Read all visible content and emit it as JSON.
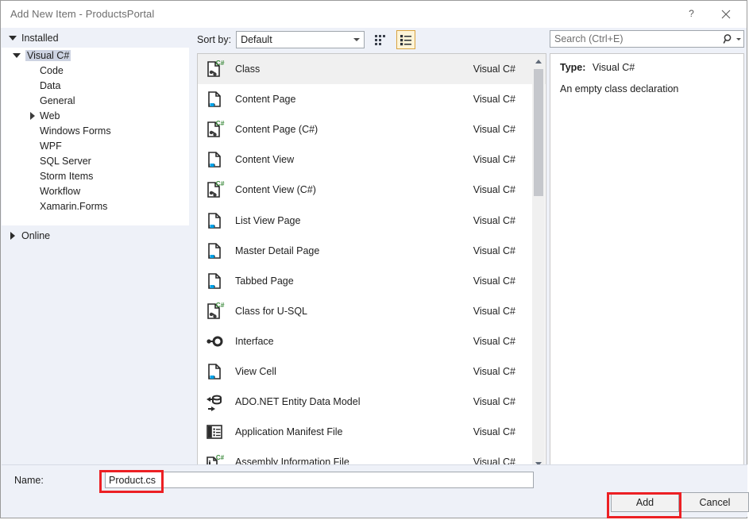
{
  "window": {
    "title": "Add New Item - ProductsPortal",
    "help_icon": "question-mark-icon",
    "close_icon": "close-icon"
  },
  "tree": {
    "installed": {
      "label": "Installed",
      "expanded_icon": "triangle-down-icon"
    },
    "online": {
      "label": "Online",
      "collapsed_icon": "triangle-right-icon"
    },
    "root": {
      "label": "Visual C#",
      "selected": true,
      "expanded_icon": "triangle-down-icon"
    },
    "children": [
      {
        "label": "Code",
        "expandable": false
      },
      {
        "label": "Data",
        "expandable": false
      },
      {
        "label": "General",
        "expandable": false
      },
      {
        "label": "Web",
        "expandable": true
      },
      {
        "label": "Windows Forms",
        "expandable": false
      },
      {
        "label": "WPF",
        "expandable": false
      },
      {
        "label": "SQL Server",
        "expandable": false
      },
      {
        "label": "Storm Items",
        "expandable": false
      },
      {
        "label": "Workflow",
        "expandable": false
      },
      {
        "label": "Xamarin.Forms",
        "expandable": false
      }
    ]
  },
  "toolbar": {
    "sort_by_label": "Sort by:",
    "sort_by_value": "Default",
    "sort_by_options": [
      "Default"
    ],
    "view_tiles_icon": "tiles-view-icon",
    "view_details_icon": "details-view-icon",
    "view_selected": "details"
  },
  "search": {
    "placeholder": "Search (Ctrl+E)",
    "value": "",
    "icon": "magnifier-icon",
    "dropdown_icon": "chevron-down-icon"
  },
  "list": {
    "selected_index": 0,
    "items": [
      {
        "name": "Class",
        "lang": "Visual C#",
        "icon": "csharp-class-file-icon"
      },
      {
        "name": "Content Page",
        "lang": "Visual C#",
        "icon": "xaml-page-file-icon"
      },
      {
        "name": "Content Page (C#)",
        "lang": "Visual C#",
        "icon": "csharp-class-file-icon"
      },
      {
        "name": "Content View",
        "lang": "Visual C#",
        "icon": "xaml-page-file-icon"
      },
      {
        "name": "Content View (C#)",
        "lang": "Visual C#",
        "icon": "csharp-class-file-icon"
      },
      {
        "name": "List View Page",
        "lang": "Visual C#",
        "icon": "xaml-page-file-icon"
      },
      {
        "name": "Master Detail Page",
        "lang": "Visual C#",
        "icon": "xaml-page-file-icon"
      },
      {
        "name": "Tabbed Page",
        "lang": "Visual C#",
        "icon": "xaml-page-file-icon"
      },
      {
        "name": "Class for U-SQL",
        "lang": "Visual C#",
        "icon": "csharp-class-file-icon"
      },
      {
        "name": "Interface",
        "lang": "Visual C#",
        "icon": "interface-icon"
      },
      {
        "name": "View Cell",
        "lang": "Visual C#",
        "icon": "xaml-page-file-icon"
      },
      {
        "name": "ADO.NET Entity Data Model",
        "lang": "Visual C#",
        "icon": "entity-data-model-icon"
      },
      {
        "name": "Application Manifest File",
        "lang": "Visual C#",
        "icon": "manifest-file-icon"
      },
      {
        "name": "Assembly Information File",
        "lang": "Visual C#",
        "icon": "assembly-info-file-icon"
      }
    ],
    "scroll_up_icon": "scroll-up-arrow-icon",
    "scroll_down_icon": "scroll-down-arrow-icon"
  },
  "details": {
    "type_label": "Type:",
    "type_value": "Visual C#",
    "description": "An empty class declaration"
  },
  "bottom": {
    "name_label": "Name:",
    "name_value": "Product.cs",
    "add_label": "Add",
    "cancel_label": "Cancel"
  },
  "colors": {
    "dialog_bg": "#eef1f8",
    "panel_bg": "#ffffff",
    "selection": "#cdd3e2",
    "row_selection": "#f0f0f0",
    "accent_amber": "#d9a441",
    "annotation_red": "#ec2024",
    "csharp_green": "#3c8a3c",
    "xaml_blue": "#00a2e8"
  },
  "annotations": [
    {
      "target": "name-input-value",
      "color": "#ec2024"
    },
    {
      "target": "add-button",
      "color": "#ec2024"
    }
  ]
}
